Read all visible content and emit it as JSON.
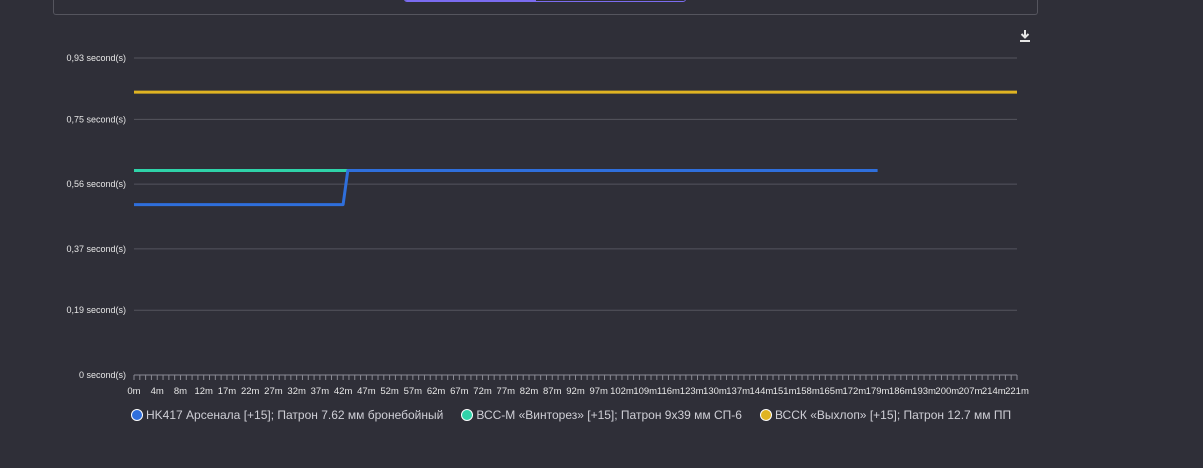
{
  "toolbar": {
    "download_icon": "download-icon"
  },
  "colors": {
    "background": "#2f2f38",
    "grid": "#55555e",
    "text": "#e6e6e6"
  },
  "chart_data": {
    "type": "line",
    "xlabel": "",
    "ylabel": "",
    "y_ticks": [
      "0 second(s)",
      "0,19 second(s)",
      "0,37 second(s)",
      "0,56 second(s)",
      "0,75 second(s)",
      "0,93 second(s)"
    ],
    "y_tick_values": [
      0,
      0.19,
      0.37,
      0.56,
      0.75,
      0.93
    ],
    "ylim": [
      0,
      0.93
    ],
    "x_ticks": [
      "0m",
      "4m",
      "8m",
      "12m",
      "17m",
      "22m",
      "27m",
      "32m",
      "37m",
      "42m",
      "47m",
      "52m",
      "57m",
      "62m",
      "67m",
      "72m",
      "77m",
      "82m",
      "87m",
      "92m",
      "97m",
      "102m",
      "109m",
      "116m",
      "123m",
      "130m",
      "137m",
      "144m",
      "151m",
      "158m",
      "165m",
      "172m",
      "179m",
      "186m",
      "193m",
      "200m",
      "207m",
      "214m",
      "221m"
    ],
    "grid": true,
    "legend_position": "bottom",
    "series": [
      {
        "name": "HK417 Арсенала [+15]; Патрон 7.62 мм бронебойный",
        "color": "#2f6fdc",
        "points": [
          [
            0,
            0.5
          ],
          [
            42,
            0.5
          ],
          [
            43,
            0.6
          ],
          [
            179,
            0.6
          ]
        ]
      },
      {
        "name": "ВСС-М «Винторез» [+15]; Патрон 9x39 мм СП-6",
        "color": "#2fd3a9",
        "points": [
          [
            0,
            0.6
          ],
          [
            169,
            0.6
          ]
        ]
      },
      {
        "name": "ВССК «Выхлоп» [+15]; Патрон 12.7 мм ПП",
        "color": "#e0b422",
        "points": [
          [
            0,
            0.83
          ],
          [
            221,
            0.83
          ]
        ]
      }
    ]
  }
}
